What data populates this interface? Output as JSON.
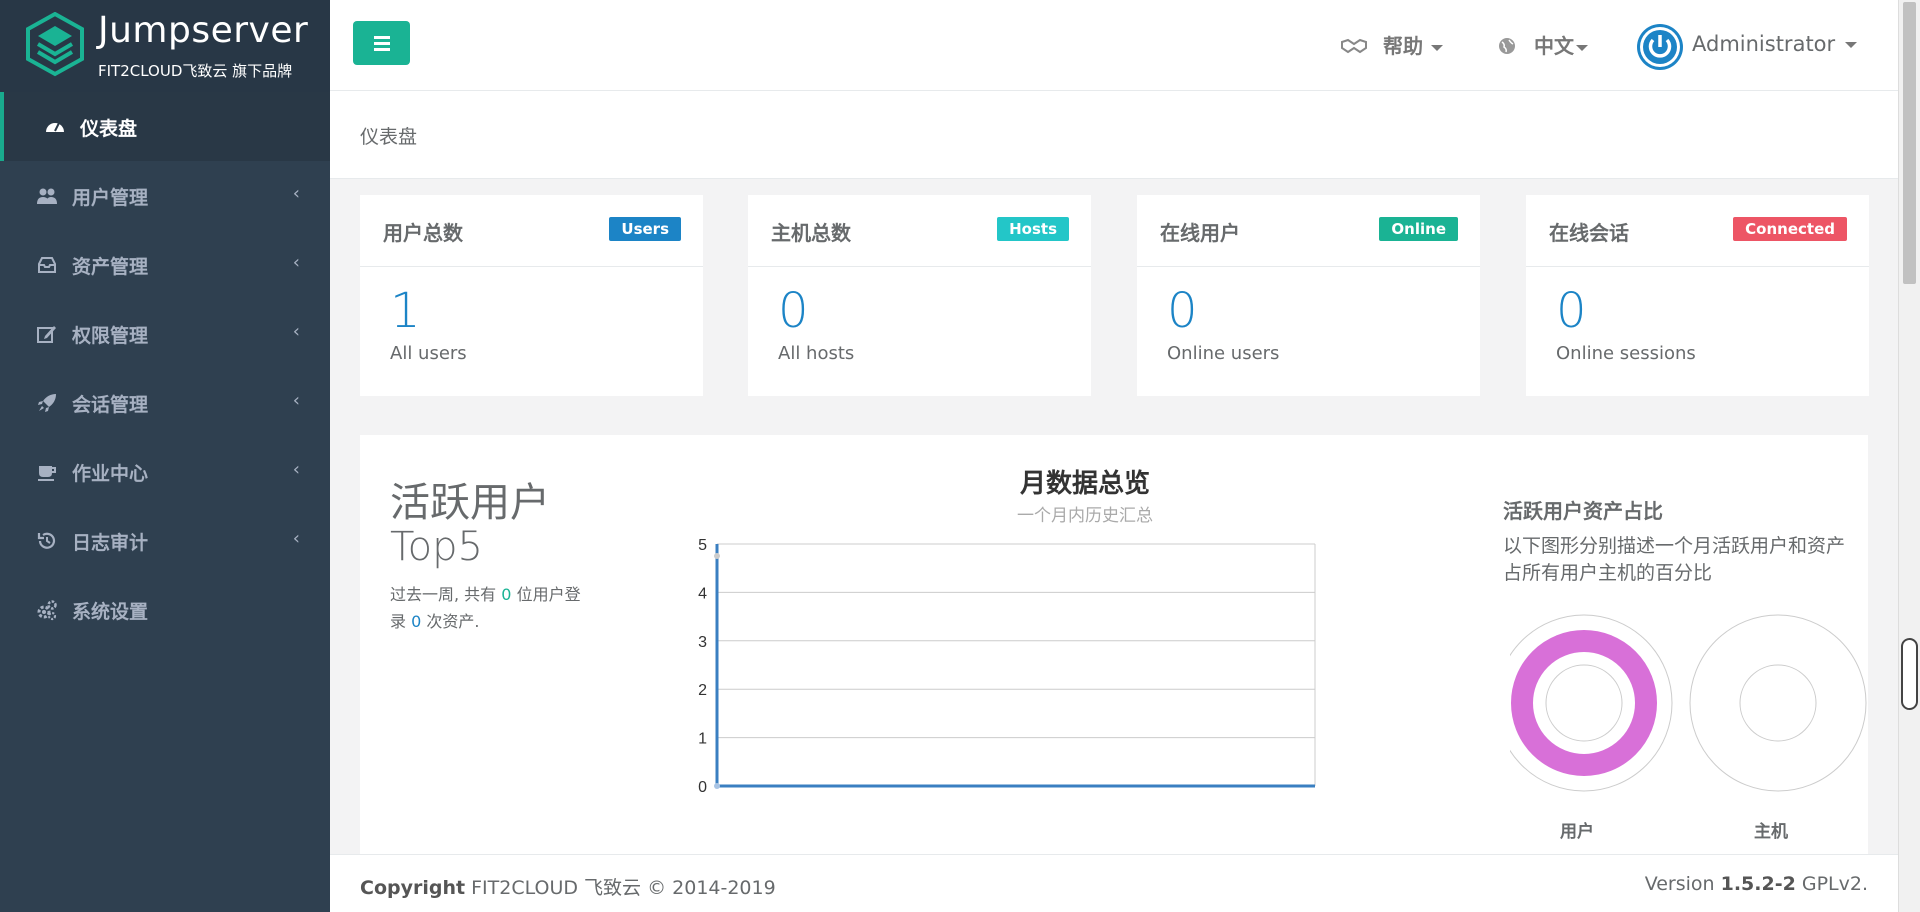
{
  "brand": {
    "name": "Jumpserver",
    "subtitle": "FIT2CLOUD飞致云 旗下品牌",
    "logo_color": "#1ab394"
  },
  "sidebar": {
    "items": [
      {
        "label": "仪表盘",
        "icon": "dashboard-icon",
        "active": true
      },
      {
        "label": "用户管理",
        "icon": "users-icon"
      },
      {
        "label": "资产管理",
        "icon": "inbox-icon"
      },
      {
        "label": "权限管理",
        "icon": "edit-icon"
      },
      {
        "label": "会话管理",
        "icon": "rocket-icon"
      },
      {
        "label": "作业中心",
        "icon": "coffee-icon"
      },
      {
        "label": "日志审计",
        "icon": "history-icon"
      },
      {
        "label": "系统设置",
        "icon": "gears-icon"
      }
    ]
  },
  "topbar": {
    "help_label": "帮助",
    "lang_label": "中文",
    "user_label": "Administrator"
  },
  "page": {
    "heading": "仪表盘"
  },
  "stats": [
    {
      "title": "用户总数",
      "badge": "Users",
      "badge_color": "#1c84c6",
      "value": "1",
      "desc": "All users"
    },
    {
      "title": "主机总数",
      "badge": "Hosts",
      "badge_color": "#23c6c8",
      "value": "0",
      "desc": "All hosts"
    },
    {
      "title": "在线用户",
      "badge": "Online",
      "badge_color": "#1ab394",
      "value": "0",
      "desc": "Online users"
    },
    {
      "title": "在线会话",
      "badge": "Connected",
      "badge_color": "#ed5565",
      "value": "0",
      "desc": "Online sessions"
    }
  ],
  "top5": {
    "title_line1": "活跃用户",
    "title_line2": "Top5",
    "desc_part1": "过去一周, 共有",
    "user_count": "0",
    "desc_part2": "位用户登",
    "desc_part3": "录",
    "asset_count": "0",
    "desc_part4": "次资产."
  },
  "chart_data": {
    "type": "line",
    "title": "月数据总览",
    "subtitle": "一个月内历史汇总",
    "ylim": [
      0,
      5
    ],
    "yticks": [
      0,
      1,
      2,
      3,
      4,
      5
    ],
    "grid": true,
    "series": [
      {
        "values": [
          0,
          0,
          0,
          0,
          0,
          0,
          0,
          0,
          0,
          0,
          0,
          0,
          0,
          0,
          0,
          0,
          0,
          0,
          0,
          0,
          0,
          0,
          0,
          0,
          0,
          0,
          0,
          0,
          0,
          0
        ],
        "color": "#3a7fc1"
      }
    ]
  },
  "ratio": {
    "title": "活跃用户资产占比",
    "desc": "以下图形分别描述一个月活跃用户和资产占所有用户主机的百分比",
    "donuts": [
      {
        "label": "用户",
        "percent": 100,
        "color": "#d870d8"
      },
      {
        "label": "主机",
        "percent": 0,
        "color": "#d870d8"
      }
    ]
  },
  "footer": {
    "copyright_bold": "Copyright",
    "copyright_rest": "FIT2CLOUD 飞致云 © 2014-2019",
    "version_prefix": "Version",
    "version_number": "1.5.2-2",
    "version_suffix": "GPLv2."
  }
}
